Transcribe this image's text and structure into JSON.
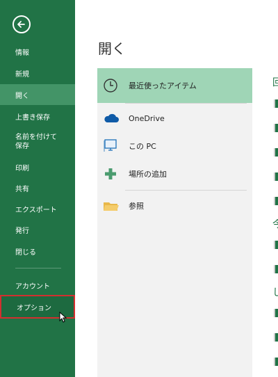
{
  "sidebar": {
    "items": [
      {
        "label": "情報"
      },
      {
        "label": "新規"
      },
      {
        "label": "開く"
      },
      {
        "label": "上書き保存"
      },
      {
        "label": "名前を付けて保存"
      },
      {
        "label": "印刷"
      },
      {
        "label": "共有"
      },
      {
        "label": "エクスポート"
      },
      {
        "label": "発行"
      },
      {
        "label": "閉じる"
      },
      {
        "label": "アカウント"
      },
      {
        "label": "オプション"
      }
    ],
    "save_as_line1": "名前を付けて",
    "save_as_line2": "保存"
  },
  "main": {
    "title": "開く",
    "locations": [
      {
        "label": "最近使ったアイテム",
        "icon": "clock-icon"
      },
      {
        "label": "OneDrive",
        "icon": "cloud-icon"
      },
      {
        "label": "この PC",
        "icon": "computer-icon"
      },
      {
        "label": "場所の追加",
        "icon": "plus-icon"
      },
      {
        "label": "参照",
        "icon": "folder-icon"
      }
    ],
    "right_partial_headers": [
      "回",
      "今",
      "し"
    ]
  },
  "colors": {
    "sidebar_bg": "#217346",
    "sidebar_active": "#439467",
    "selected_location": "#9fd5b6",
    "highlight_border": "#d32f2f"
  }
}
